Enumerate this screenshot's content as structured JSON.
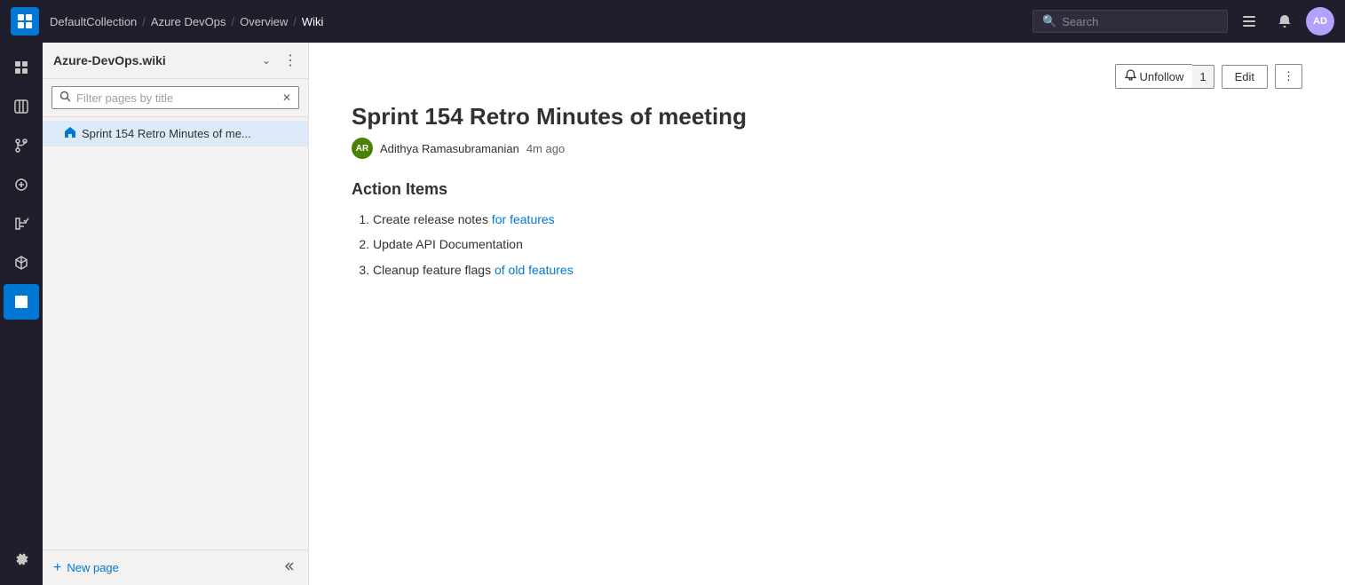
{
  "topNav": {
    "logoAlt": "Azure DevOps",
    "breadcrumbs": [
      {
        "label": "DefaultCollection",
        "href": "#"
      },
      {
        "label": "Azure DevOps",
        "href": "#"
      },
      {
        "label": "Overview",
        "href": "#"
      },
      {
        "label": "Wiki",
        "href": "#",
        "current": true
      }
    ],
    "search": {
      "placeholder": "Search",
      "value": ""
    },
    "userInitials": "AD"
  },
  "iconSidebar": {
    "items": [
      {
        "name": "home-icon",
        "symbol": "⊞",
        "active": false
      },
      {
        "name": "boards-icon",
        "symbol": "▦",
        "active": false
      },
      {
        "name": "repos-icon",
        "symbol": "⎇",
        "active": false
      },
      {
        "name": "pipelines-icon",
        "symbol": "⚙",
        "active": false
      },
      {
        "name": "testplans-icon",
        "symbol": "✓",
        "active": false
      },
      {
        "name": "artifacts-icon",
        "symbol": "⬡",
        "active": false
      },
      {
        "name": "wiki-icon",
        "symbol": "📄",
        "active": true
      }
    ],
    "bottomItems": [
      {
        "name": "settings-icon",
        "symbol": "⚙"
      }
    ]
  },
  "pageListPanel": {
    "title": "Azure-DevOps.wiki",
    "filterPlaceholder": "Filter pages by title",
    "filterValue": "",
    "pages": [
      {
        "label": "Sprint 154 Retro Minutes of me...",
        "active": true
      }
    ],
    "newPageLabel": "New page"
  },
  "contentArea": {
    "pageTitle": "Sprint 154 Retro Minutes of meeting",
    "authorInitials": "AR",
    "authorName": "Adithya Ramasubramanian",
    "timeAgo": "4m ago",
    "unfollowLabel": "Unfollow",
    "followerCount": "1",
    "editLabel": "Edit",
    "moreLabel": "···",
    "sectionTitle": "Action Items",
    "actionItems": [
      {
        "text": "Create release notes ",
        "linkText": "for features",
        "link": true
      },
      {
        "text": "Update API Documentation",
        "linkText": "",
        "link": false
      },
      {
        "text": "Cleanup feature flags ",
        "linkText": "of old features",
        "link": true
      }
    ]
  }
}
